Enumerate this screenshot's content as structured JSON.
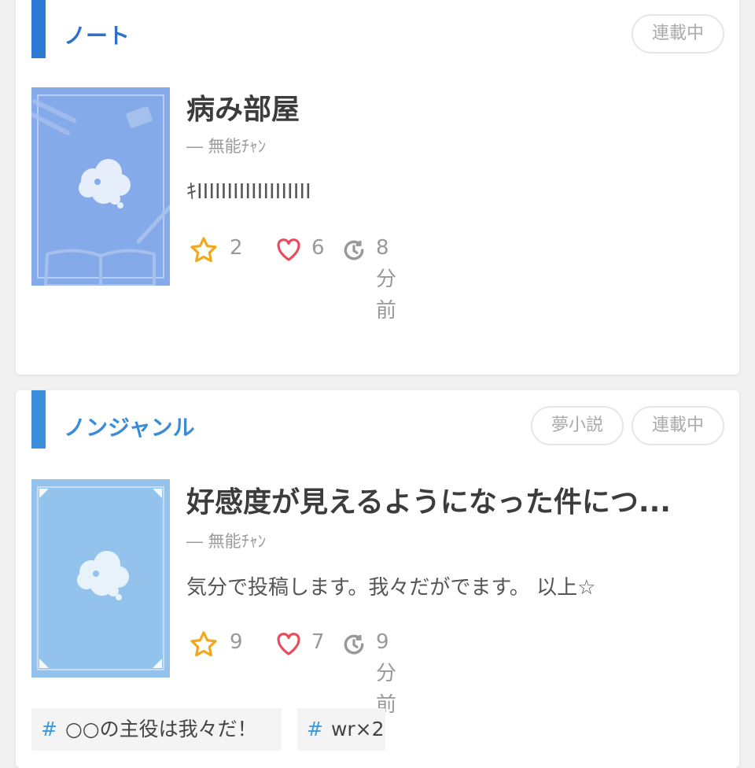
{
  "cards": [
    {
      "genre": "ノート",
      "badges": [
        "連載中"
      ],
      "title": "病み部屋",
      "author": "― 無能ﾁｬﾝ",
      "description": "ｷIIIIIIIIIIIIIIIIIII",
      "stars": "2",
      "likes": "6",
      "updated": "8分前",
      "colors": {
        "bar": "#2f79d6",
        "cover": "#85aae9"
      }
    },
    {
      "genre": "ノンジャンル",
      "badges": [
        "夢小説",
        "連載中"
      ],
      "title": "好感度が見えるようになった件につ...",
      "author": "― 無能ﾁｬﾝ",
      "description": "気分で投稿します。我々だがでます。 以上☆",
      "stars": "9",
      "likes": "7",
      "updated": "9分前",
      "tags": [
        "○○の主役は我々だ！",
        "wr×2"
      ],
      "colors": {
        "bar": "#3c8fdc",
        "cover": "#93c3ec"
      }
    }
  ],
  "icons": {
    "star": "star-icon",
    "heart": "heart-icon",
    "clock": "clock-icon",
    "tag": "hash-icon"
  },
  "accent": {
    "star": "#f3a81c",
    "heart": "#ea4a5a",
    "clock": "#999999",
    "tag_hash": "#3a9be0"
  }
}
